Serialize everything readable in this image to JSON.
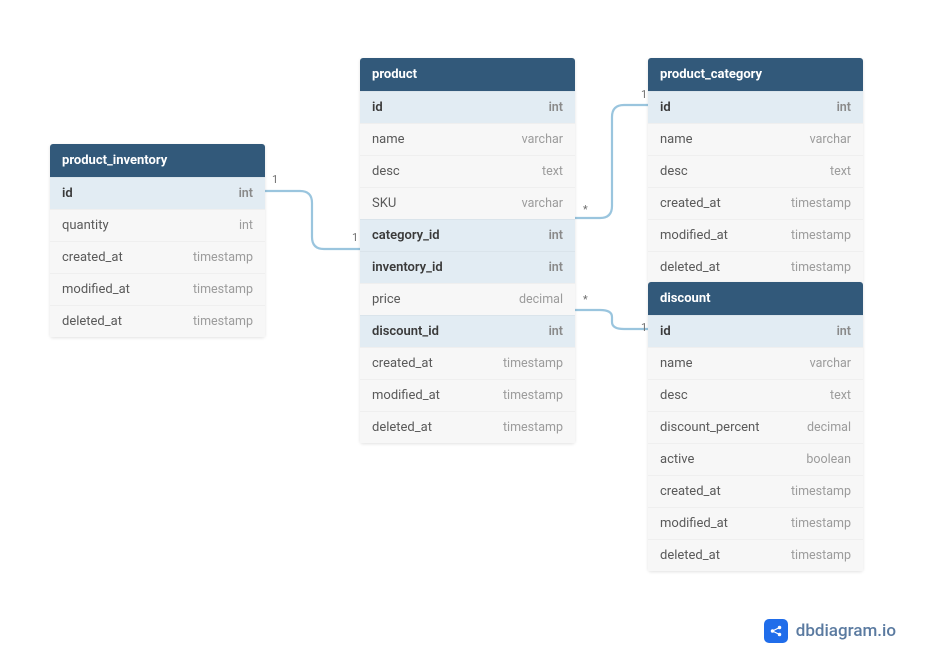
{
  "tables": {
    "product_inventory": {
      "title": "product_inventory",
      "rows": [
        {
          "name": "id",
          "type": "int",
          "hl": true
        },
        {
          "name": "quantity",
          "type": "int",
          "hl": false
        },
        {
          "name": "created_at",
          "type": "timestamp",
          "hl": false
        },
        {
          "name": "modified_at",
          "type": "timestamp",
          "hl": false
        },
        {
          "name": "deleted_at",
          "type": "timestamp",
          "hl": false
        }
      ]
    },
    "product": {
      "title": "product",
      "rows": [
        {
          "name": "id",
          "type": "int",
          "hl": true
        },
        {
          "name": "name",
          "type": "varchar",
          "hl": false
        },
        {
          "name": "desc",
          "type": "text",
          "hl": false
        },
        {
          "name": "SKU",
          "type": "varchar",
          "hl": false
        },
        {
          "name": "category_id",
          "type": "int",
          "hl": true
        },
        {
          "name": "inventory_id",
          "type": "int",
          "hl": true
        },
        {
          "name": "price",
          "type": "decimal",
          "hl": false
        },
        {
          "name": "discount_id",
          "type": "int",
          "hl": true
        },
        {
          "name": "created_at",
          "type": "timestamp",
          "hl": false
        },
        {
          "name": "modified_at",
          "type": "timestamp",
          "hl": false
        },
        {
          "name": "deleted_at",
          "type": "timestamp",
          "hl": false
        }
      ]
    },
    "product_category": {
      "title": "product_category",
      "rows": [
        {
          "name": "id",
          "type": "int",
          "hl": true
        },
        {
          "name": "name",
          "type": "varchar",
          "hl": false
        },
        {
          "name": "desc",
          "type": "text",
          "hl": false
        },
        {
          "name": "created_at",
          "type": "timestamp",
          "hl": false
        },
        {
          "name": "modified_at",
          "type": "timestamp",
          "hl": false
        },
        {
          "name": "deleted_at",
          "type": "timestamp",
          "hl": false
        }
      ]
    },
    "discount": {
      "title": "discount",
      "rows": [
        {
          "name": "id",
          "type": "int",
          "hl": true
        },
        {
          "name": "name",
          "type": "varchar",
          "hl": false
        },
        {
          "name": "desc",
          "type": "text",
          "hl": false
        },
        {
          "name": "discount_percent",
          "type": "decimal",
          "hl": false
        },
        {
          "name": "active",
          "type": "boolean",
          "hl": false
        },
        {
          "name": "created_at",
          "type": "timestamp",
          "hl": false
        },
        {
          "name": "modified_at",
          "type": "timestamp",
          "hl": false
        },
        {
          "name": "deleted_at",
          "type": "timestamp",
          "hl": false
        }
      ]
    }
  },
  "cardinality": {
    "inv_one": "1",
    "prod_invone": "1",
    "prod_cat_star": "*",
    "cat_one": "1",
    "prod_disc_star": "*",
    "disc_one": "1"
  },
  "brand": {
    "text": "dbdiagram.io"
  },
  "chart_data": {
    "type": "erd",
    "entities": [
      {
        "name": "product_inventory",
        "pk": [
          "id"
        ],
        "columns": [
          "id:int",
          "quantity:int",
          "created_at:timestamp",
          "modified_at:timestamp",
          "deleted_at:timestamp"
        ]
      },
      {
        "name": "product",
        "pk": [
          "id"
        ],
        "columns": [
          "id:int",
          "name:varchar",
          "desc:text",
          "SKU:varchar",
          "category_id:int",
          "inventory_id:int",
          "price:decimal",
          "discount_id:int",
          "created_at:timestamp",
          "modified_at:timestamp",
          "deleted_at:timestamp"
        ]
      },
      {
        "name": "product_category",
        "pk": [
          "id"
        ],
        "columns": [
          "id:int",
          "name:varchar",
          "desc:text",
          "created_at:timestamp",
          "modified_at:timestamp",
          "deleted_at:timestamp"
        ]
      },
      {
        "name": "discount",
        "pk": [
          "id"
        ],
        "columns": [
          "id:int",
          "name:varchar",
          "desc:text",
          "discount_percent:decimal",
          "active:boolean",
          "created_at:timestamp",
          "modified_at:timestamp",
          "deleted_at:timestamp"
        ]
      }
    ],
    "relationships": [
      {
        "from": "product.inventory_id",
        "to": "product_inventory.id",
        "cardinality": "1-1"
      },
      {
        "from": "product.category_id",
        "to": "product_category.id",
        "cardinality": "*-1"
      },
      {
        "from": "product.discount_id",
        "to": "discount.id",
        "cardinality": "*-1"
      }
    ]
  }
}
